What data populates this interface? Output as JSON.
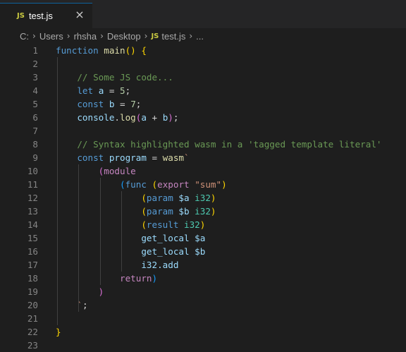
{
  "tab": {
    "badge": "JS",
    "title": "test.js",
    "close_icon": "×"
  },
  "breadcrumb": {
    "items": [
      "C:",
      "Users",
      "rhsha",
      "Desktop"
    ],
    "file_badge": "JS",
    "file": "test.js",
    "more": "..."
  },
  "editor": {
    "line_numbers": [
      "1",
      "2",
      "3",
      "4",
      "5",
      "6",
      "7",
      "8",
      "9",
      "10",
      "11",
      "12",
      "13",
      "14",
      "15",
      "16",
      "17",
      "18",
      "19",
      "20",
      "21",
      "22",
      "23"
    ],
    "lines": [
      [
        [
          "kw",
          "function "
        ],
        [
          "fn",
          "main"
        ],
        [
          "p1",
          "()"
        ],
        [
          "plain",
          " "
        ],
        [
          "p1",
          "{"
        ]
      ],
      [],
      [
        [
          "cm",
          "    // Some JS code..."
        ]
      ],
      [
        [
          "plain",
          "    "
        ],
        [
          "kw",
          "let "
        ],
        [
          "var",
          "a"
        ],
        [
          "plain",
          " = "
        ],
        [
          "num",
          "5"
        ],
        [
          "plain",
          ";"
        ]
      ],
      [
        [
          "plain",
          "    "
        ],
        [
          "kw",
          "const "
        ],
        [
          "var",
          "b"
        ],
        [
          "plain",
          " = "
        ],
        [
          "num",
          "7"
        ],
        [
          "plain",
          ";"
        ]
      ],
      [
        [
          "plain",
          "    "
        ],
        [
          "var",
          "console"
        ],
        [
          "plain",
          "."
        ],
        [
          "fn",
          "log"
        ],
        [
          "p2",
          "("
        ],
        [
          "var",
          "a"
        ],
        [
          "plain",
          " + "
        ],
        [
          "var",
          "b"
        ],
        [
          "p2",
          ")"
        ],
        [
          "plain",
          ";"
        ]
      ],
      [],
      [
        [
          "cm",
          "    // Syntax highlighted wasm in a 'tagged template literal'"
        ]
      ],
      [
        [
          "plain",
          "    "
        ],
        [
          "kw",
          "const "
        ],
        [
          "var",
          "program"
        ],
        [
          "plain",
          " = "
        ],
        [
          "fn",
          "wasm"
        ],
        [
          "tpl",
          "`"
        ]
      ],
      [
        [
          "plain",
          "        "
        ],
        [
          "p2",
          "("
        ],
        [
          "ctrl",
          "module"
        ]
      ],
      [
        [
          "plain",
          "            "
        ],
        [
          "p3",
          "("
        ],
        [
          "kw",
          "func "
        ],
        [
          "p1",
          "("
        ],
        [
          "ctrl",
          "export "
        ],
        [
          "str",
          "\"sum\""
        ],
        [
          "p1",
          ")"
        ]
      ],
      [
        [
          "plain",
          "                "
        ],
        [
          "p1",
          "("
        ],
        [
          "kw",
          "param "
        ],
        [
          "var",
          "$a "
        ],
        [
          "type",
          "i32"
        ],
        [
          "p1",
          ")"
        ]
      ],
      [
        [
          "plain",
          "                "
        ],
        [
          "p1",
          "("
        ],
        [
          "kw",
          "param "
        ],
        [
          "var",
          "$b "
        ],
        [
          "type",
          "i32"
        ],
        [
          "p1",
          ")"
        ]
      ],
      [
        [
          "plain",
          "                "
        ],
        [
          "p1",
          "("
        ],
        [
          "kw",
          "result "
        ],
        [
          "type",
          "i32"
        ],
        [
          "p1",
          ")"
        ]
      ],
      [
        [
          "plain",
          "                "
        ],
        [
          "var",
          "get_local "
        ],
        [
          "var",
          "$a"
        ]
      ],
      [
        [
          "plain",
          "                "
        ],
        [
          "var",
          "get_local "
        ],
        [
          "var",
          "$b"
        ]
      ],
      [
        [
          "plain",
          "                "
        ],
        [
          "var",
          "i32.add"
        ]
      ],
      [
        [
          "plain",
          "            "
        ],
        [
          "ctrl",
          "return"
        ],
        [
          "p3",
          ")"
        ]
      ],
      [
        [
          "plain",
          "        "
        ],
        [
          "p2",
          ")"
        ]
      ],
      [
        [
          "plain",
          "    "
        ],
        [
          "tpl",
          "`"
        ],
        [
          "plain",
          ";"
        ]
      ],
      [],
      [
        [
          "p1",
          "}"
        ]
      ],
      []
    ]
  }
}
